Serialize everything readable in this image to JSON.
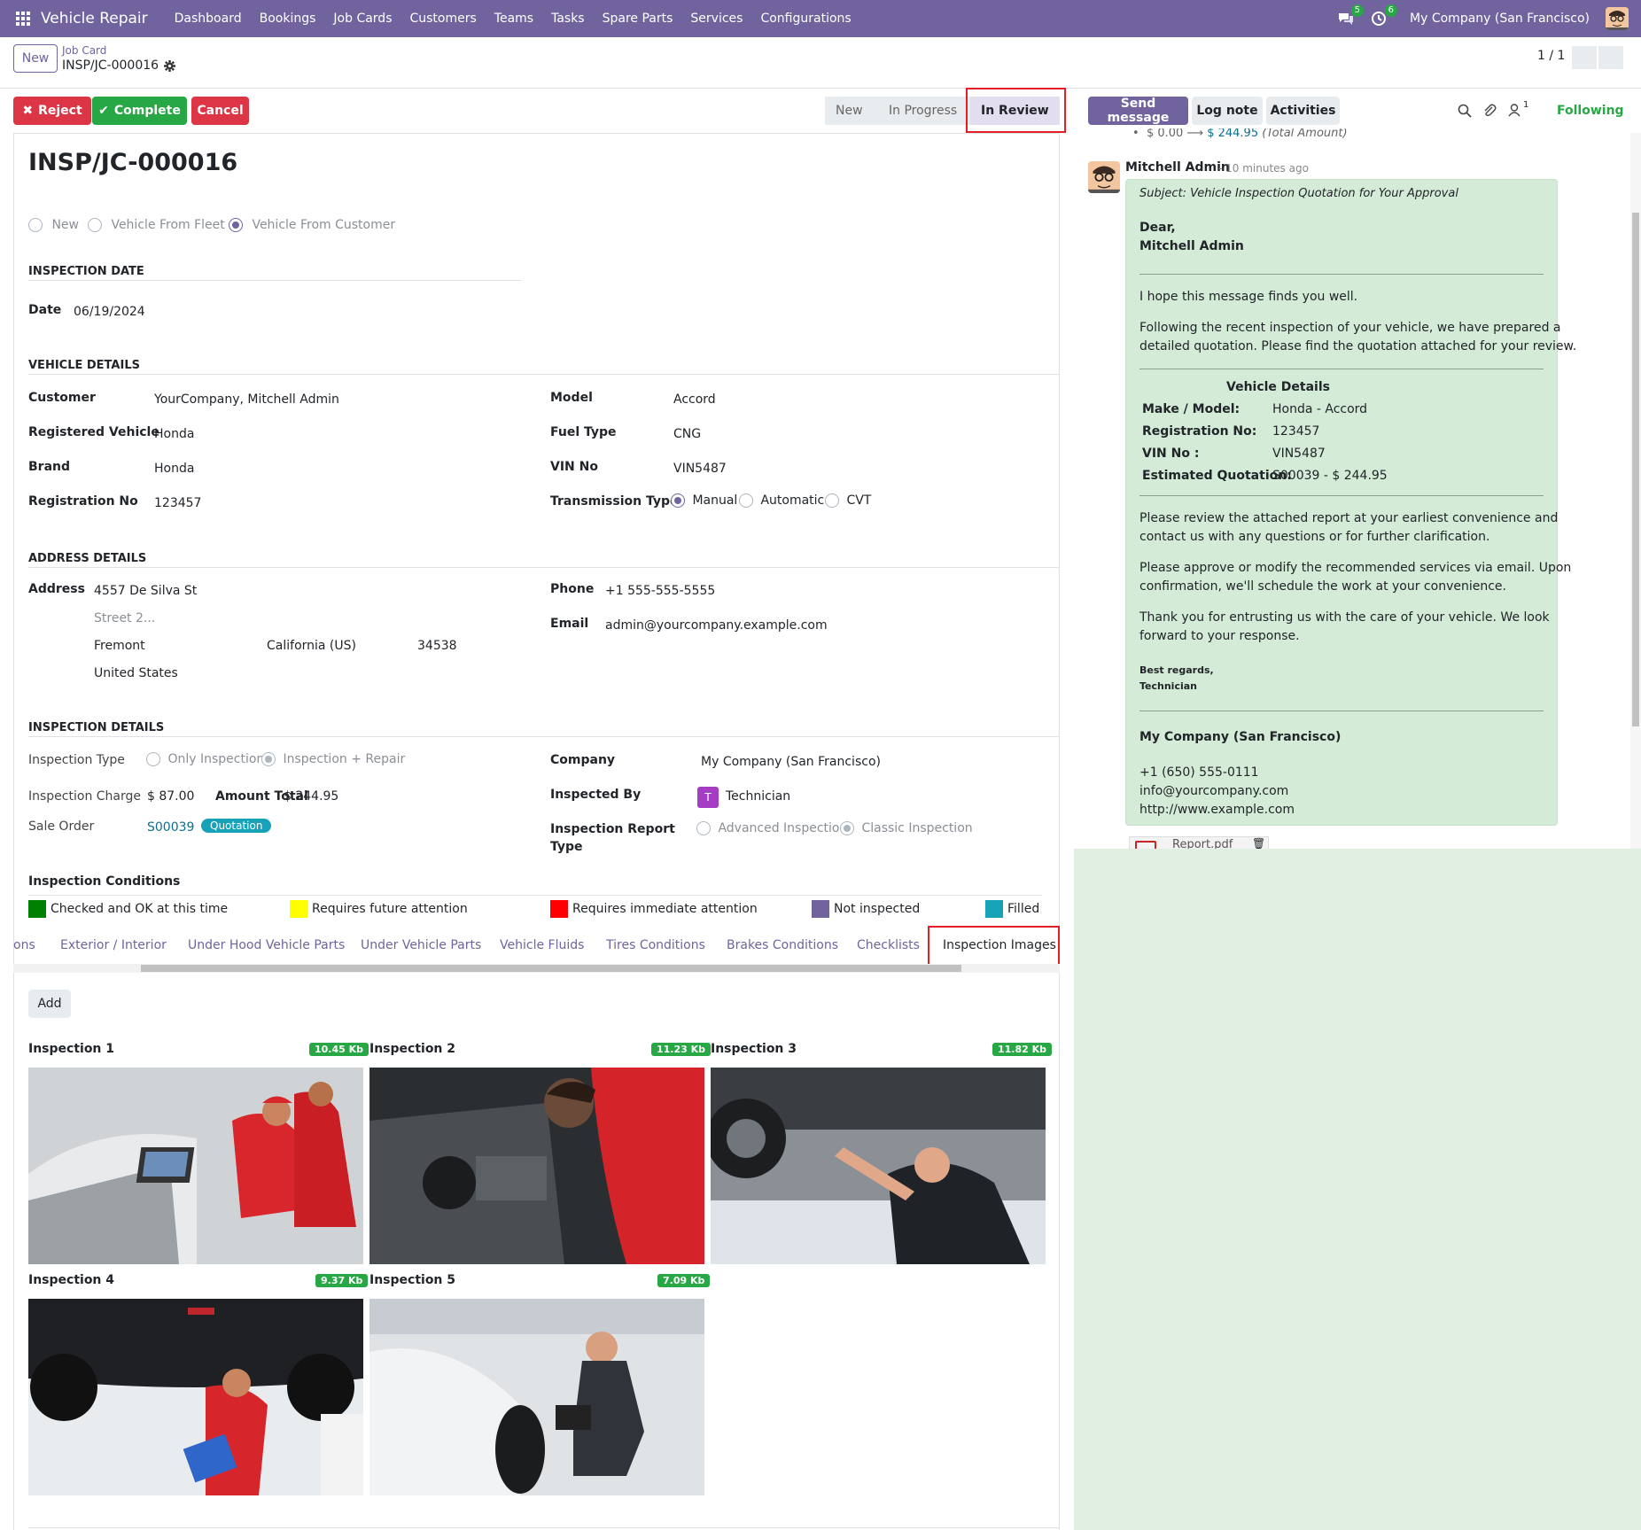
{
  "nav": {
    "app_name": "Vehicle Repair",
    "menu": [
      "Dashboard",
      "Bookings",
      "Job Cards",
      "Customers",
      "Teams",
      "Tasks",
      "Spare Parts",
      "Services",
      "Configurations"
    ],
    "messages_count": "5",
    "activities_count": "6",
    "company": "My Company (San Francisco)"
  },
  "control": {
    "new_label": "New",
    "breadcrumb_parent": "Job Card",
    "breadcrumb_current": "INSP/JC-000016",
    "pager": "1 / 1"
  },
  "actions": {
    "reject": "Reject",
    "complete": "Complete",
    "cancel": "Cancel"
  },
  "stages": [
    "New",
    "In Progress",
    "In Review"
  ],
  "active_stage": "In Review",
  "form": {
    "title": "INSP/JC-000016",
    "source_options": [
      "New",
      "Vehicle From Fleet",
      "Vehicle From Customer"
    ],
    "source_selected": "Vehicle From Customer",
    "inspection_date_header": "INSPECTION DATE",
    "date_label": "Date",
    "date_value": "06/19/2024",
    "vehicle_header": "VEHICLE DETAILS",
    "customer_label": "Customer",
    "customer_value": "YourCompany, Mitchell Admin",
    "registered_vehicle_label": "Registered Vehicle",
    "registered_vehicle_value": "Honda",
    "brand_label": "Brand",
    "brand_value": "Honda",
    "registration_label": "Registration No",
    "registration_value": "123457",
    "model_label": "Model",
    "model_value": "Accord",
    "fuel_label": "Fuel Type",
    "fuel_value": "CNG",
    "vin_label": "VIN No",
    "vin_value": "VIN5487",
    "transmission_label": "Transmission Type",
    "transmission_options": [
      "Manual",
      "Automatic",
      "CVT"
    ],
    "transmission_selected": "Manual",
    "address_header": "ADDRESS DETAILS",
    "address_label": "Address",
    "street": "4557 De Silva St",
    "street2_placeholder": "Street 2...",
    "city": "Fremont",
    "state": "California (US)",
    "zip": "34538",
    "country": "United States",
    "phone_label": "Phone",
    "phone_value": "+1 555-555-5555",
    "email_label": "Email",
    "email_value": "admin@yourcompany.example.com",
    "inspection_header": "INSPECTION DETAILS",
    "inspection_type_label": "Inspection Type",
    "inspection_type_options": [
      "Only Inspection",
      "Inspection + Repair"
    ],
    "inspection_type_selected": "Inspection + Repair",
    "inspection_charge_label": "Inspection Charge",
    "inspection_charge_value": "$ 87.00",
    "amount_total_label": "Amount Total",
    "amount_total_value": "$ 244.95",
    "sale_order_label": "Sale Order",
    "sale_order_value": "S00039",
    "sale_order_badge": "Quotation",
    "company_label": "Company",
    "company_value": "My Company (San Francisco)",
    "inspected_by_label": "Inspected By",
    "inspected_by_initial": "T",
    "inspected_by_value": "Technician",
    "report_type_label_1": "Inspection Report",
    "report_type_label_2": "Type",
    "report_type_options": [
      "Advanced Inspection",
      "Classic Inspection"
    ],
    "report_type_selected": "Classic Inspection",
    "conditions_header": "Inspection Conditions",
    "conditions": [
      {
        "label": "Checked and OK at this time",
        "color": "#008000"
      },
      {
        "label": "Requires future attention",
        "color": "#ffff00"
      },
      {
        "label": "Requires immediate attention",
        "color": "#ff0000"
      },
      {
        "label": "Not inspected",
        "color": "#71639e"
      },
      {
        "label": "Filled",
        "color": "#17a2b8"
      }
    ]
  },
  "tabs": [
    "ons",
    "Exterior / Interior",
    "Under Hood Vehicle Parts",
    "Under Vehicle Parts",
    "Vehicle Fluids",
    "Tires Conditions",
    "Brakes Conditions",
    "Checklists",
    "Inspection Images"
  ],
  "active_tab": "Inspection Images",
  "images": {
    "add_label": "Add",
    "items": [
      {
        "title": "Inspection 1",
        "size": "10.45 Kb"
      },
      {
        "title": "Inspection 2",
        "size": "11.23 Kb"
      },
      {
        "title": "Inspection 3",
        "size": "11.82 Kb"
      },
      {
        "title": "Inspection 4",
        "size": "9.37 Kb"
      },
      {
        "title": "Inspection 5",
        "size": "7.09 Kb"
      }
    ]
  },
  "chatter": {
    "send_message": "Send message",
    "log_note": "Log note",
    "activities": "Activities",
    "followers_count": "1",
    "following": "Following",
    "prev_change_old": "$ 0.00",
    "prev_change_new": "$ 244.95",
    "prev_change_field": "(Total Amount)",
    "author": "Mitchell Admin",
    "time": "- 10 minutes ago",
    "subject": "Subject: Vehicle Inspection Quotation for Your Approval",
    "greeting": "Dear,",
    "recipient": "Mitchell Admin",
    "p1": "I hope this message finds you well.",
    "p2a": "Following the recent inspection of your vehicle, we have prepared a",
    "p2b": "detailed quotation. Please find the quotation attached for your review.",
    "vd_title": "Vehicle Details",
    "vd_rows": [
      {
        "k": "Make / Model:",
        "v": "Honda - Accord"
      },
      {
        "k": "Registration No:",
        "v": "123457"
      },
      {
        "k": "VIN No :",
        "v": "VIN5487"
      },
      {
        "k": "Estimated Quotation:",
        "v": "S00039 - $ 244.95"
      }
    ],
    "p3a": "Please review the attached report at your earliest convenience and",
    "p3b": "contact us with any questions or for further clarification.",
    "p4a": "Please approve or modify the recommended services via email. Upon",
    "p4b": "confirmation, we'll schedule the work at your convenience.",
    "p5a": "Thank you for entrusting us with the care of your vehicle. We look",
    "p5b": "forward to your response.",
    "regards": "Best regards,",
    "signer": "Technician",
    "company": "My Company (San Francisco)",
    "phone": "+1 (650) 555-0111",
    "email": "info@yourcompany.com",
    "website": "http://www.example.com",
    "attachment": "Report.pdf"
  }
}
